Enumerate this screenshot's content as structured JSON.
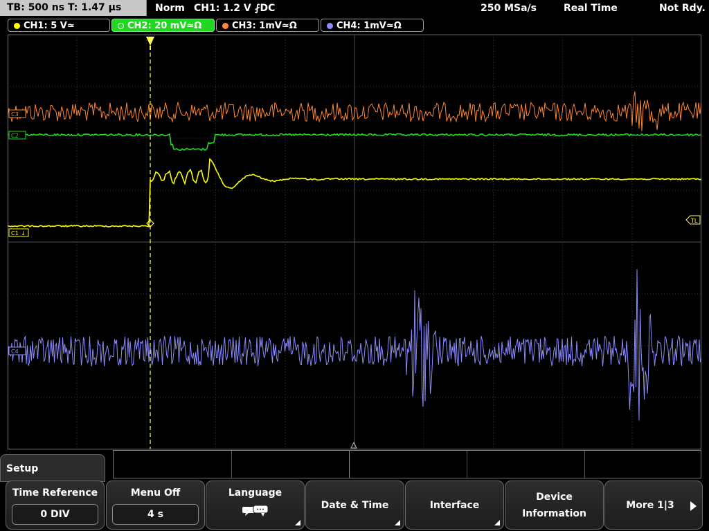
{
  "topbar": {
    "tb": "TB: 500 ns   T: 1.47 µs",
    "mode": "Norm",
    "trigger": "CH1: 1.2 V ⨏DC",
    "sample_rate": "250 MSa/s",
    "acq": "Real Time",
    "status": "Not Rdy."
  },
  "channels": [
    {
      "label": "CH1: 5 V≃",
      "color": "#ffff00",
      "selected": false
    },
    {
      "label": "CH2: 20 mV≃Ω",
      "color": "#22dd22",
      "selected": true
    },
    {
      "label": "CH3: 1mV≃Ω",
      "color": "#ff8833",
      "selected": false
    },
    {
      "label": "CH4: 1mV≃Ω",
      "color": "#8c8cff",
      "selected": false
    }
  ],
  "markers": {
    "c3": "C3",
    "c2": "C2",
    "c1": "C1",
    "c4": "C4",
    "tl": "TL"
  },
  "setup_tab": "Setup",
  "softkeys": [
    {
      "title": "Time Reference",
      "value": "0 DIV"
    },
    {
      "title": "Menu Off",
      "value": "4 s"
    },
    {
      "title": "Language",
      "icon": "speech-bubbles-icon"
    },
    {
      "title": "Date & Time"
    },
    {
      "title": "Interface"
    },
    {
      "title": "Device Information"
    },
    {
      "title": "More 1|3"
    }
  ],
  "colors": {
    "ch1": "#ffff00",
    "ch2": "#22dd22",
    "ch3": "#ff8833",
    "ch4": "#8c8cff",
    "trigger": "#ffff55",
    "grid": "#444444"
  }
}
